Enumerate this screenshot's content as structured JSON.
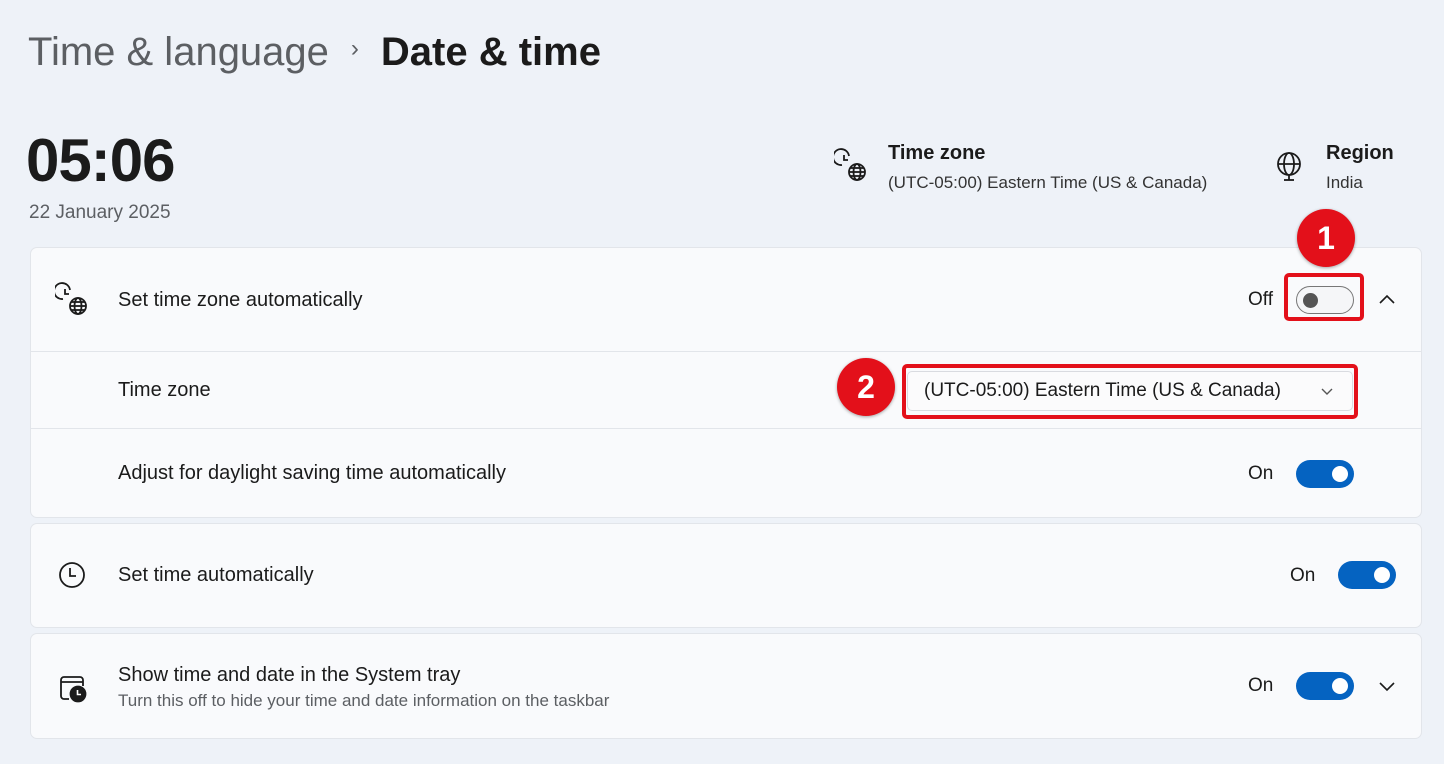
{
  "breadcrumb": {
    "parent": "Time & language",
    "separator": "›",
    "current": "Date & time"
  },
  "clock": {
    "time": "05:06",
    "date": "22 January 2025"
  },
  "header_info": {
    "time_zone": {
      "icon": "clock-globe-icon",
      "title": "Time zone",
      "value": "(UTC-05:00) Eastern Time (US & Canada)"
    },
    "region": {
      "icon": "globe-icon",
      "title": "Region",
      "value": "India"
    }
  },
  "settings": {
    "set_time_zone_auto": {
      "icon": "clock-globe-icon",
      "label": "Set time zone automatically",
      "state_label": "Off",
      "enabled": false,
      "expanded": true
    },
    "time_zone": {
      "label": "Time zone",
      "selected": "(UTC-05:00) Eastern Time (US & Canada)"
    },
    "daylight_saving": {
      "label": "Adjust for daylight saving time automatically",
      "state_label": "On",
      "enabled": true
    },
    "set_time_auto": {
      "icon": "clock-icon",
      "label": "Set time automatically",
      "state_label": "On",
      "enabled": true
    },
    "system_tray": {
      "icon": "calendar-clock-icon",
      "label": "Show time and date in the System tray",
      "description": "Turn this off to hide your time and date information on the taskbar",
      "state_label": "On",
      "enabled": true,
      "expanded": false
    }
  },
  "annotations": [
    {
      "number": "1",
      "target": "set-time-zone-automatically-toggle"
    },
    {
      "number": "2",
      "target": "time-zone-dropdown"
    }
  ],
  "colors": {
    "accent": "#0563c1",
    "annotation": "#e3101a",
    "background": "#eef2f8",
    "card": "#f9fafc"
  }
}
